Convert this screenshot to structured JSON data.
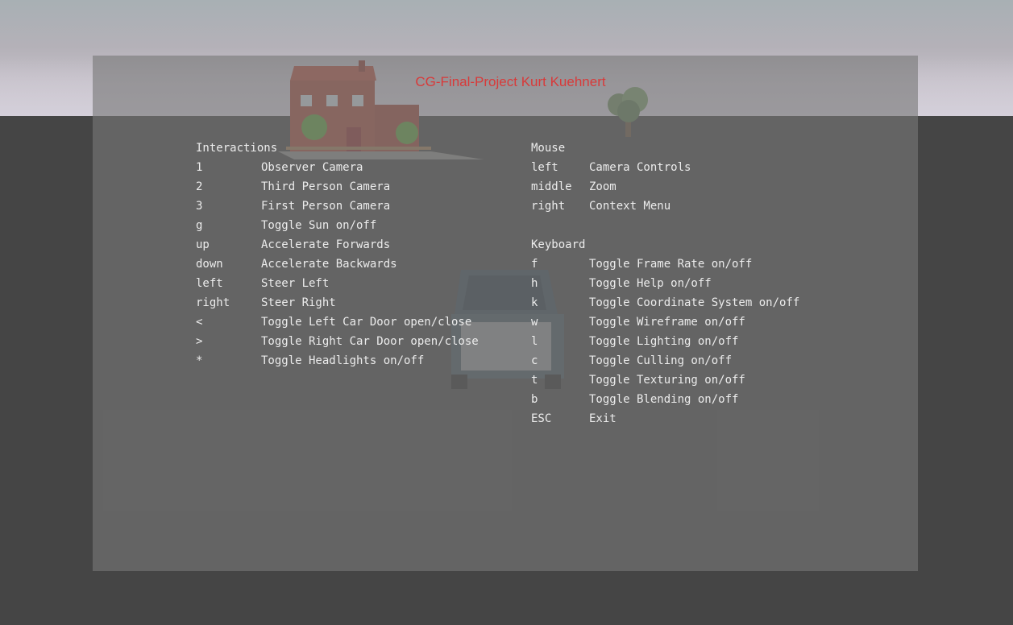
{
  "title": "CG-Final-Project Kurt Kuehnert",
  "interactions": {
    "heading": "Interactions",
    "items": [
      {
        "key": "1",
        "action": "Observer Camera"
      },
      {
        "key": "2",
        "action": "Third Person Camera"
      },
      {
        "key": "3",
        "action": "First Person Camera"
      },
      {
        "key": "g",
        "action": "Toggle Sun on/off"
      },
      {
        "key": "up",
        "action": "Accelerate Forwards"
      },
      {
        "key": "down",
        "action": "Accelerate Backwards"
      },
      {
        "key": "left",
        "action": "Steer Left"
      },
      {
        "key": "right",
        "action": "Steer Right"
      },
      {
        "key": "<",
        "action": "Toggle Left Car Door open/close"
      },
      {
        "key": ">",
        "action": "Toggle Right Car Door open/close"
      },
      {
        "key": "*",
        "action": "Toggle Headlights on/off"
      }
    ]
  },
  "mouse": {
    "heading": "Mouse",
    "items": [
      {
        "key": "left",
        "action": "Camera Controls"
      },
      {
        "key": "middle",
        "action": "Zoom"
      },
      {
        "key": "right",
        "action": "Context Menu"
      }
    ]
  },
  "keyboard": {
    "heading": "Keyboard",
    "items": [
      {
        "key": "f",
        "action": "Toggle Frame Rate on/off"
      },
      {
        "key": "h",
        "action": "Toggle Help on/off"
      },
      {
        "key": "k",
        "action": "Toggle Coordinate System on/off"
      },
      {
        "key": "w",
        "action": "Toggle Wireframe on/off"
      },
      {
        "key": "l",
        "action": "Toggle Lighting on/off"
      },
      {
        "key": "c",
        "action": "Toggle Culling on/off"
      },
      {
        "key": "t",
        "action": "Toggle Texturing on/off"
      },
      {
        "key": "b",
        "action": "Toggle Blending on/off"
      },
      {
        "key": "ESC",
        "action": "Exit"
      }
    ]
  },
  "colors": {
    "title": "#d83a3a",
    "text": "#ececec",
    "ground": "#454545"
  },
  "scene": {
    "objects": [
      "house",
      "tree",
      "car"
    ]
  }
}
